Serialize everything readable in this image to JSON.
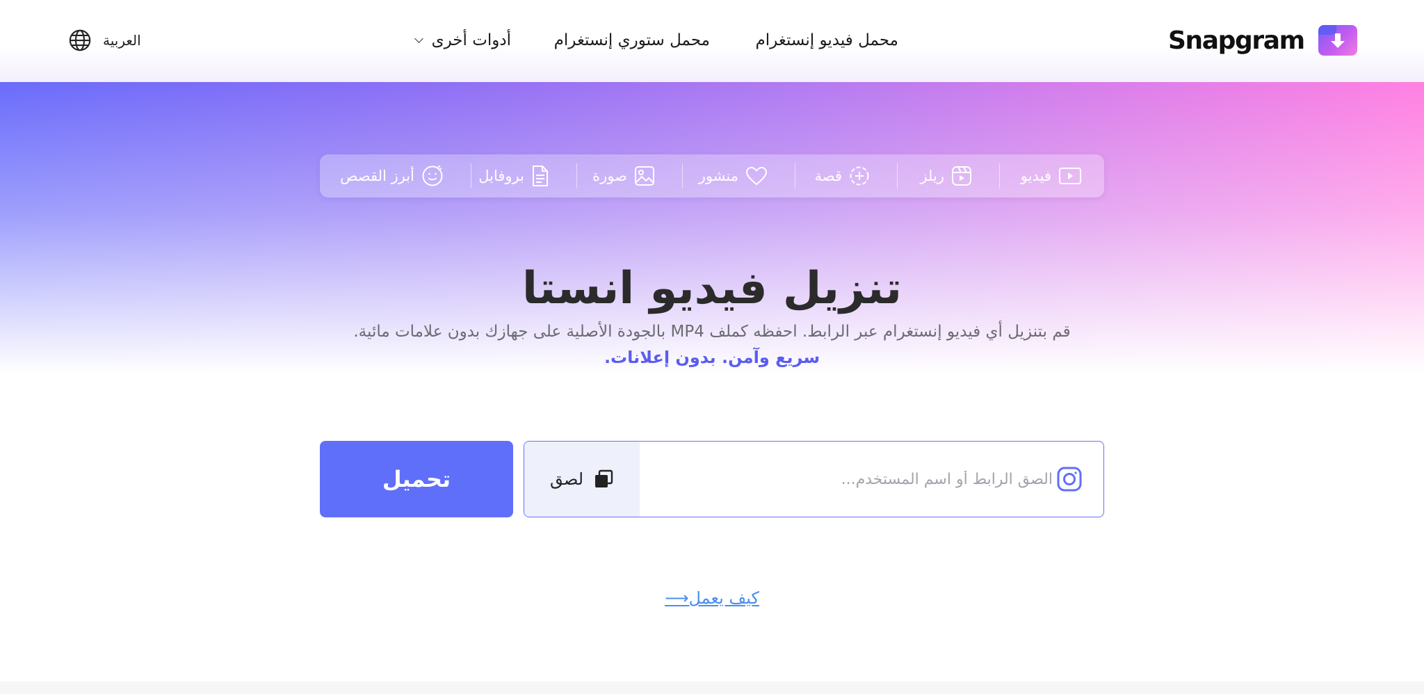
{
  "brand": {
    "name": "Snapgram"
  },
  "nav": {
    "items": [
      {
        "label": "محمل فيديو إنستغرام"
      },
      {
        "label": "محمل ستوري إنستغرام"
      },
      {
        "label": "أدوات أخرى"
      }
    ],
    "language": "العربية"
  },
  "tabs": [
    {
      "label": "فيديو",
      "icon": "video-icon"
    },
    {
      "label": "ريلز",
      "icon": "reels-icon"
    },
    {
      "label": "قصة",
      "icon": "story-plus-icon"
    },
    {
      "label": "منشور",
      "icon": "heart-icon"
    },
    {
      "label": "صورة",
      "icon": "image-icon"
    },
    {
      "label": "بروفايل",
      "icon": "document-icon"
    },
    {
      "label": "أبرز القصص",
      "icon": "smile-icon"
    }
  ],
  "hero": {
    "title": "تنزيل فيديو انستا",
    "subtitle": "قم بتنزيل أي فيديو إنستغرام عبر الرابط. احفظه كملف MP4 بالجودة الأصلية على جهازك بدون علامات مائية.",
    "tagline": "سريع وآمن. بدون إعلانات."
  },
  "form": {
    "placeholder": "الصق الرابط أو اسم المستخدم...",
    "paste_label": "لصق",
    "download_label": "تحميل"
  },
  "how_link": "كيف يعمل",
  "colors": {
    "accent": "#5f6ff9",
    "link": "#4b8cf0",
    "tagline": "#5a5df0"
  }
}
